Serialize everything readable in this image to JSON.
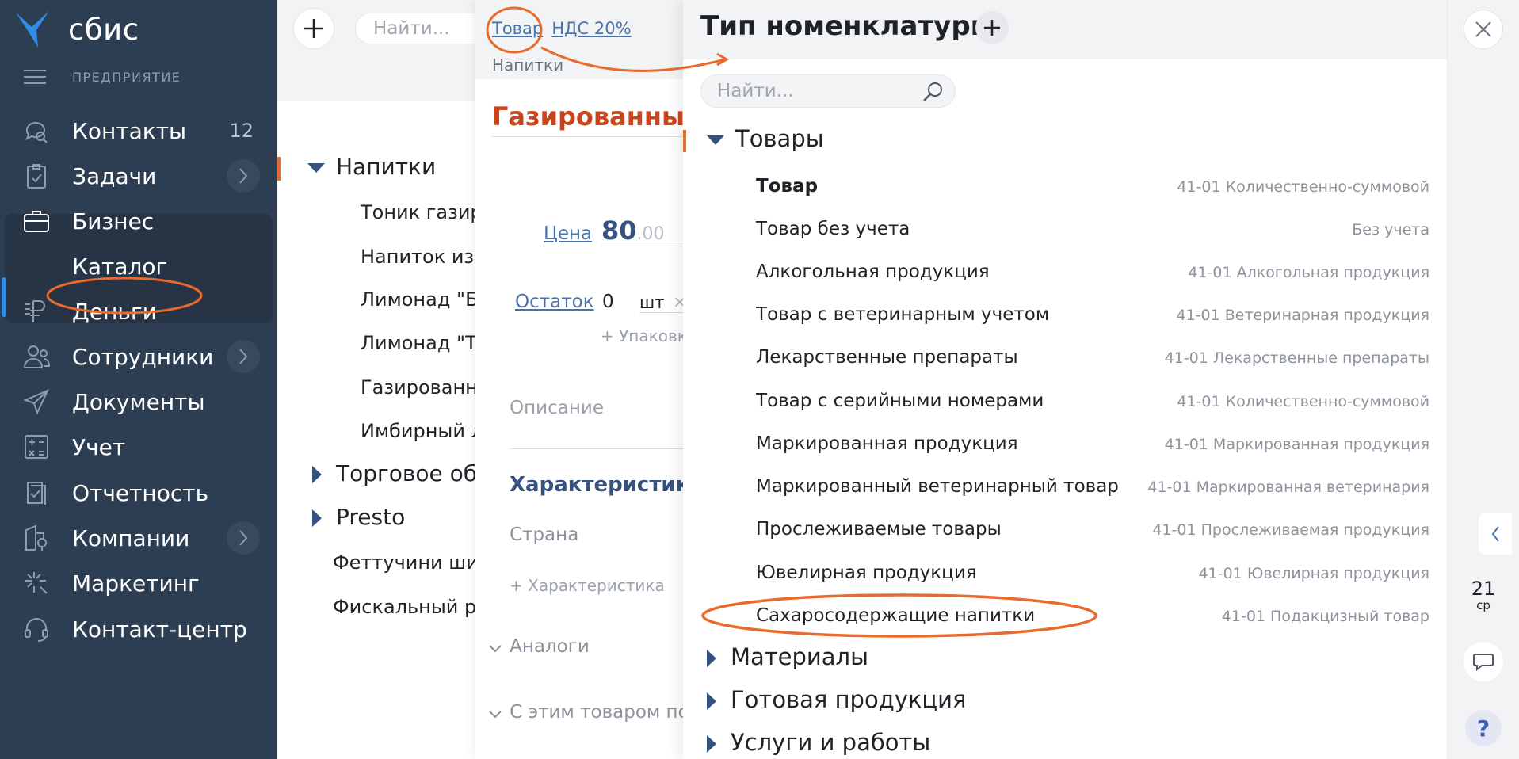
{
  "app": {
    "logo_text": "сбис",
    "subtitle": "ПРЕДПРИЯТИЕ"
  },
  "sidebar": {
    "items": [
      {
        "label": "Контакты",
        "badge": "12",
        "icon": "chat-search-icon"
      },
      {
        "label": "Задачи",
        "icon": "clipboard-check-icon",
        "chevron": true
      },
      {
        "label": "Бизнес",
        "icon": "briefcase-icon"
      },
      {
        "label": "Каталог",
        "icon": "",
        "active": true
      },
      {
        "label": "Деньги",
        "icon": "ruble-icon"
      },
      {
        "label": "Сотрудники",
        "icon": "people-icon",
        "chevron": true
      },
      {
        "label": "Документы",
        "icon": "paper-plane-icon"
      },
      {
        "label": "Учет",
        "icon": "calculator-icon"
      },
      {
        "label": "Отчетность",
        "icon": "report-check-icon"
      },
      {
        "label": "Компании",
        "icon": "building-pin-icon",
        "chevron": true
      },
      {
        "label": "Маркетинг",
        "icon": "sparkle-cursor-icon"
      },
      {
        "label": "Контакт-центр",
        "icon": "headset-icon"
      }
    ]
  },
  "catalog": {
    "search_placeholder": "Найти...",
    "tree": [
      {
        "label": "Напитки",
        "expanded": true
      },
      {
        "label": "Тоник газир"
      },
      {
        "label": "Напиток из"
      },
      {
        "label": "Лимонад \"Б"
      },
      {
        "label": "Лимонад \"Т"
      },
      {
        "label": "Газированн"
      },
      {
        "label": "Имбирный л"
      },
      {
        "label": "Торговое обо",
        "collapsed": true
      },
      {
        "label": "Presto",
        "collapsed": true
      },
      {
        "label": "Феттучини ши"
      },
      {
        "label": "Фискальный р"
      }
    ]
  },
  "card": {
    "type_link": "Товар",
    "vat_link": "НДС 20%",
    "breadcrumb": "Напитки",
    "title": "Газированный н",
    "price_label": "Цена",
    "price_value": "80",
    "price_cents": ".00",
    "stock_label": "Остаток",
    "stock_value": "0",
    "unit": "шт",
    "add_package": "+ Упаковк",
    "description_placeholder": "Описание",
    "characteristics_header": "Характеристики",
    "country_label": "Страна",
    "add_characteristic": "+ Характеристика",
    "analogs": "Аналоги",
    "bought_with": "С этим товаром по"
  },
  "nomenclature": {
    "title": "Тип номенклатуры",
    "search_placeholder": "Найти...",
    "groups": [
      {
        "label": "Товары",
        "expanded": true
      },
      {
        "label": "Материалы"
      },
      {
        "label": "Готовая продукция"
      },
      {
        "label": "Услуги и работы"
      }
    ],
    "rows": [
      {
        "name": "Товар",
        "account": "41-01 Количественно-суммовой",
        "bold": true
      },
      {
        "name": "Товар без учета",
        "account": "Без учета"
      },
      {
        "name": "Алкогольная продукция",
        "account": "41-01 Алкогольная продукция"
      },
      {
        "name": "Товар с ветеринарным учетом",
        "account": "41-01 Ветеринарная продукция"
      },
      {
        "name": "Лекарственные препараты",
        "account": "41-01 Лекарственные препараты"
      },
      {
        "name": "Товар с серийными номерами",
        "account": "41-01 Количественно-суммовой"
      },
      {
        "name": "Маркированная продукция",
        "account": "41-01 Маркированная продукция"
      },
      {
        "name": "Маркированный ветеринарный товар",
        "account": "41-01 Маркированная ветеринария"
      },
      {
        "name": "Прослеживаемые товары",
        "account": "41-01 Прослеживаемая продукция"
      },
      {
        "name": "Ювелирная продукция",
        "account": "41-01 Ювелирная продукция"
      },
      {
        "name": "Сахаросодержащие напитки",
        "account": "41-01 Подакцизный товар"
      }
    ]
  },
  "right": {
    "day": "21",
    "weekday": "ср",
    "help": "?"
  },
  "colors": {
    "sidebar_bg": "#2e3e52",
    "accent_orange": "#e86a2c",
    "title_red": "#c9451b",
    "link_blue": "#4a74a8"
  }
}
